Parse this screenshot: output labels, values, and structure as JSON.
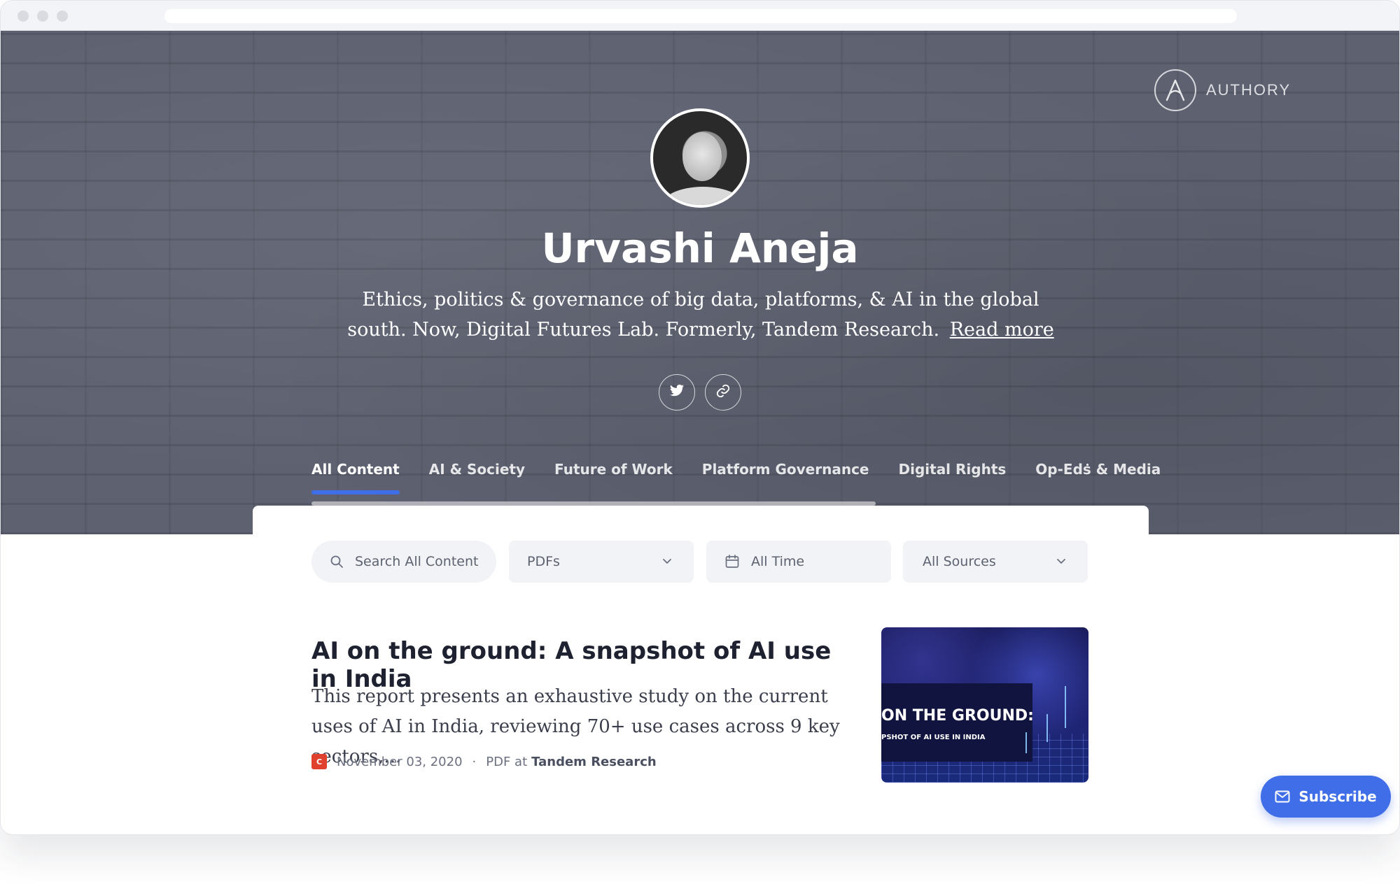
{
  "brand": {
    "name": "AUTHORY",
    "logo_icon": "authory-logo-icon"
  },
  "profile": {
    "name": "Urvashi Aneja",
    "bio": "Ethics, politics & governance of big data, platforms, & AI in the global south. Now, Digital Futures Lab. Formerly, Tandem Research.",
    "read_more_label": "Read more",
    "social_links": [
      {
        "icon": "twitter-icon"
      },
      {
        "icon": "link-icon"
      }
    ]
  },
  "tabs": [
    {
      "label": "All Content",
      "active": true
    },
    {
      "label": "AI & Society",
      "active": false
    },
    {
      "label": "Future of Work",
      "active": false
    },
    {
      "label": "Platform Governance",
      "active": false
    },
    {
      "label": "Digital Rights",
      "active": false
    },
    {
      "label": "Op-Eds & Media",
      "active": false
    }
  ],
  "filters": {
    "search_placeholder": "Search All Content",
    "type_selected": "PDFs",
    "time_selected": "All Time",
    "sources_selected": "All Sources"
  },
  "articles": [
    {
      "title": "AI on the ground: A snapshot of AI use in India",
      "summary": "This report presents an exhaustive study on the current uses of AI in India, reviewing 70+ use cases across 9 key sectors,...",
      "source_badge": "C",
      "date": "November 03, 2020",
      "format": "PDF at",
      "publisher": "Tandem Research",
      "thumbnail": {
        "headline": "ON THE GROUND:",
        "subheadline": "PSHOT OF AI USE IN INDIA"
      }
    }
  ],
  "subscribe_label": "Subscribe",
  "colors": {
    "accent": "#3f6ee8",
    "hero_bg": "#5d6170",
    "source_badge": "#e0412f"
  }
}
